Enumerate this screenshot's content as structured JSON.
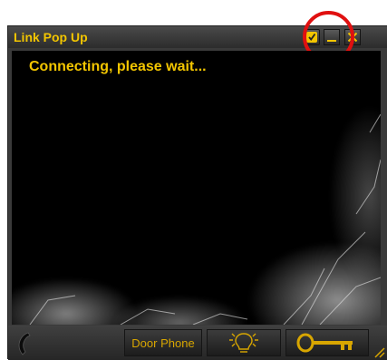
{
  "window": {
    "title": "Link Pop Up",
    "status_text": "Connecting, please wait..."
  },
  "titlebar_buttons": {
    "pin_icon": "pin-checkmark-icon",
    "minimize_icon": "minimize-icon",
    "close_icon": "close-icon"
  },
  "bottom_bar": {
    "phone_icon": "handset-icon",
    "door_phone_label": "Door Phone",
    "light_icon": "light-bulb-icon",
    "key_icon": "key-icon"
  },
  "colors": {
    "accent": "#f2c500",
    "button_text": "#d8a600",
    "highlight_ring": "#e01010",
    "video_bg": "#000000",
    "frame": "#3a3a3a"
  }
}
